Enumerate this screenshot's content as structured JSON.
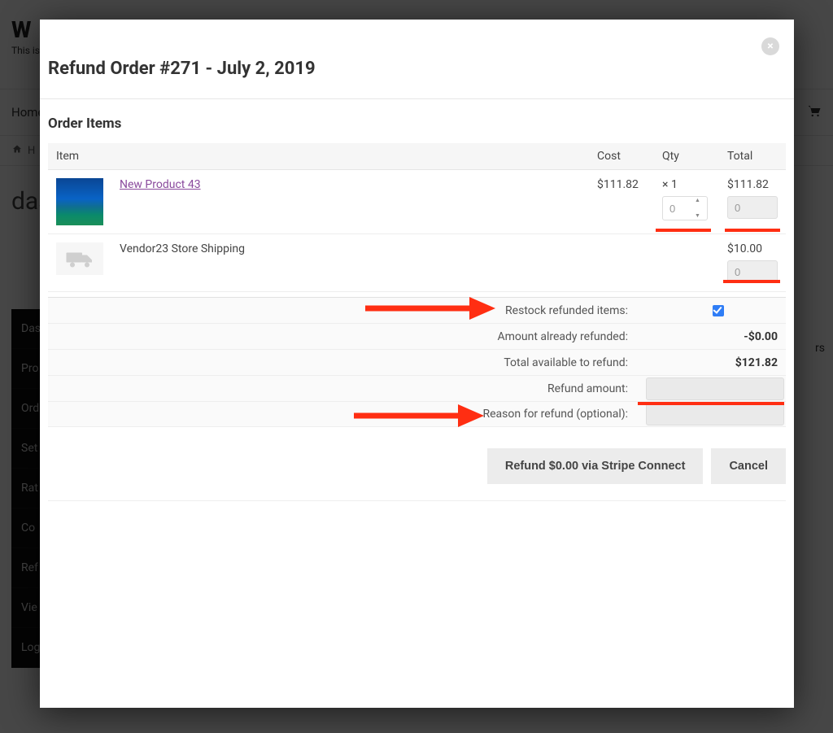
{
  "background": {
    "site_title_fragment": "W",
    "subtitle_fragment": "This is",
    "nav_home": "Home",
    "breadcrumb_home": "H",
    "dash_heading_fragment": "das",
    "sidebar": [
      "Das",
      "Pro",
      "Ord",
      "Set",
      "Rat",
      "Co",
      "Ref",
      "Vie",
      "Log"
    ],
    "right_fragment": "rs"
  },
  "modal": {
    "close_glyph": "×",
    "title": "Refund Order #271 - July 2, 2019",
    "section_title": "Order Items",
    "thead": {
      "item": "Item",
      "cost": "Cost",
      "qty": "Qty",
      "total": "Total"
    },
    "rows": [
      {
        "type": "product",
        "name": "New Product 43",
        "cost": "$111.82",
        "qty": "× 1",
        "qty_input": "0",
        "total": "$111.82",
        "total_input": "0"
      },
      {
        "type": "shipping",
        "name": "Vendor23 Store Shipping",
        "cost": "",
        "qty": "",
        "total": "$10.00",
        "total_input": "0"
      }
    ],
    "summary": {
      "restock_label": "Restock refunded items:",
      "restock_checked": true,
      "already_label": "Amount already refunded:",
      "already_value": "-$0.00",
      "available_label": "Total available to refund:",
      "available_value": "$121.82",
      "amount_label": "Refund amount:",
      "reason_label": "Reason for refund (optional):"
    },
    "buttons": {
      "refund": "Refund $0.00 via Stripe Connect",
      "cancel": "Cancel"
    }
  },
  "colors": {
    "annotation": "#ff2e12",
    "link": "#8a4a9d",
    "checkbox": "#2f7df6"
  }
}
